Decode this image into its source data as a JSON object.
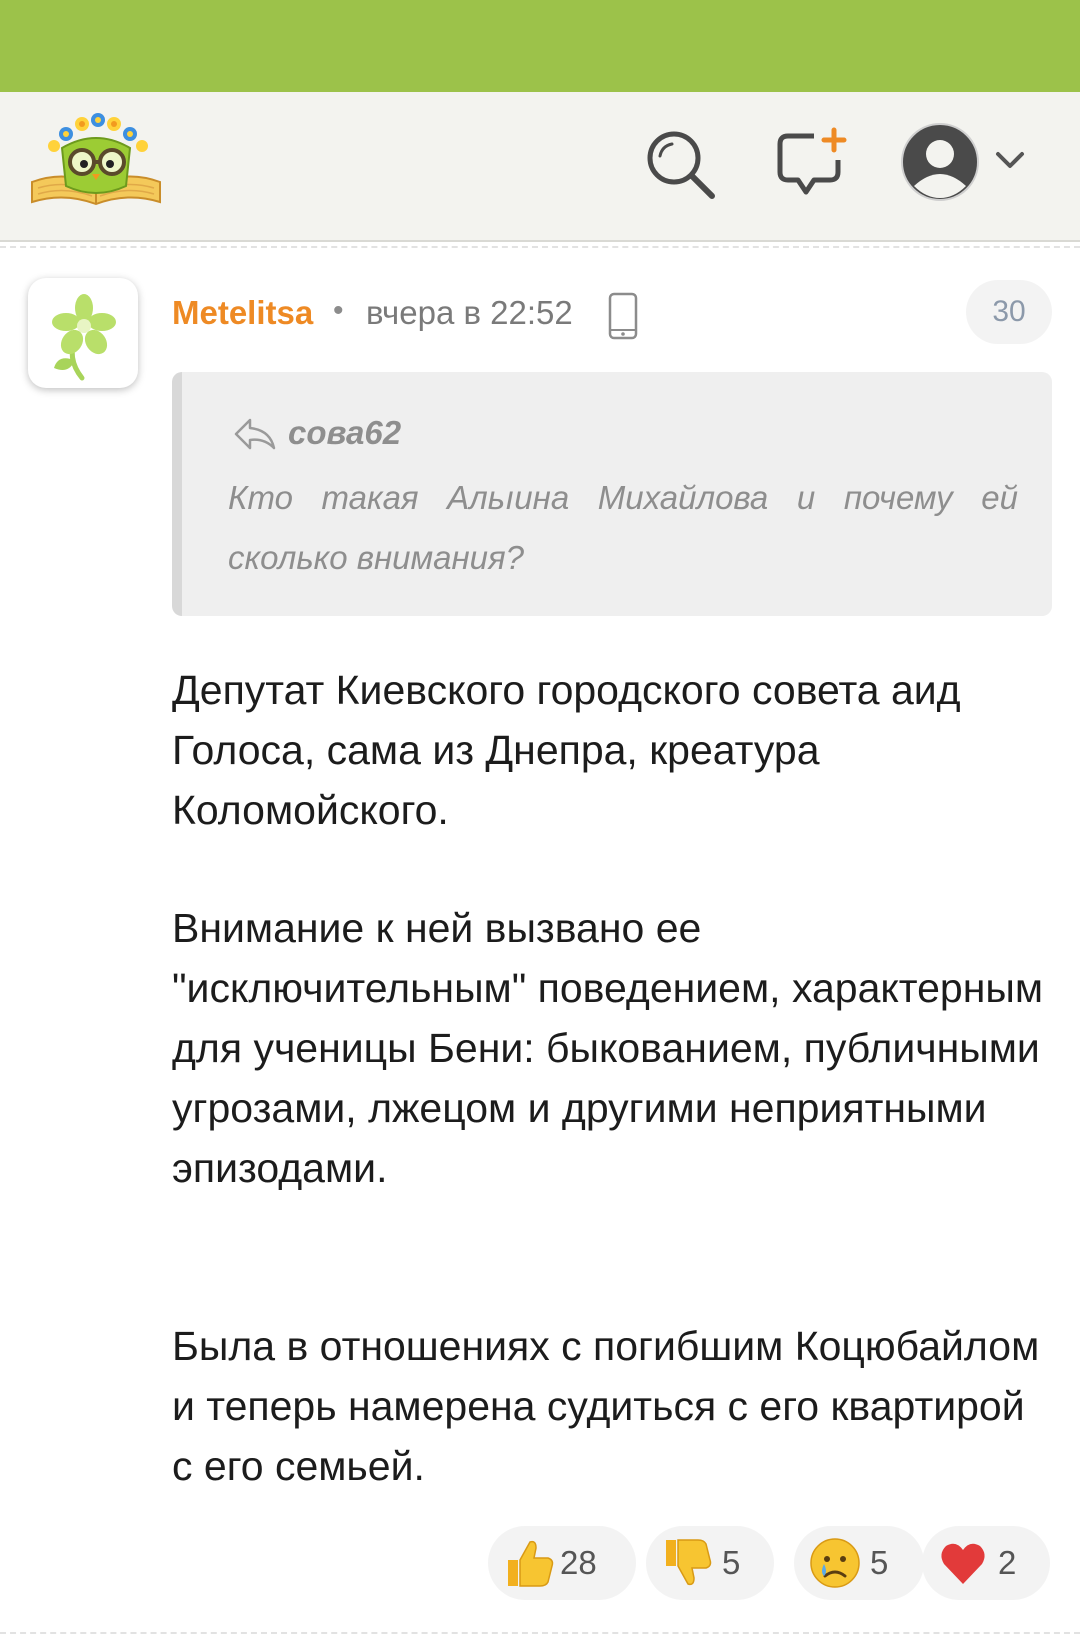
{
  "colors": {
    "status_bar": "#9cc24a",
    "header_bg": "#f3f3ef",
    "author": "#ee8a24",
    "counter_text": "#8c99aa"
  },
  "header": {
    "logo_icon": "owl-books-logo-icon",
    "search_icon": "search-icon",
    "compose_icon": "new-message-icon",
    "account_icon": "user-avatar-icon",
    "menu_icon": "chevron-down-icon"
  },
  "comment": {
    "author": "Metelitsa",
    "separator": "•",
    "timestamp": "вчера в 22:52",
    "device_icon": "mobile-phone-icon",
    "counter": "30",
    "quote": {
      "author": "сова62",
      "text": "Кто такая Альıина Михайлова и почему ей сколько внимания?"
    },
    "paragraphs": [
      "Депутат Киевского городского совета аид Голоса, сама из Днепра, креатура Коломойского.",
      "Внимание к ней вызвано ее \"исключительным\" поведением, характерным для ученицы Бени: быкованием, публичными угрозами, лжецом и другими неприятными эпизодами.",
      "Была в отношениях с погибшим Коцюбайлом и теперь намерена судиться с его квартирой с его семьей."
    ],
    "reactions": [
      {
        "icon": "thumbs-up-icon",
        "count": "28"
      },
      {
        "icon": "thumbs-down-icon",
        "count": "5"
      },
      {
        "icon": "crying-face-icon",
        "count": "5"
      },
      {
        "icon": "heart-icon",
        "count": "2"
      }
    ]
  }
}
